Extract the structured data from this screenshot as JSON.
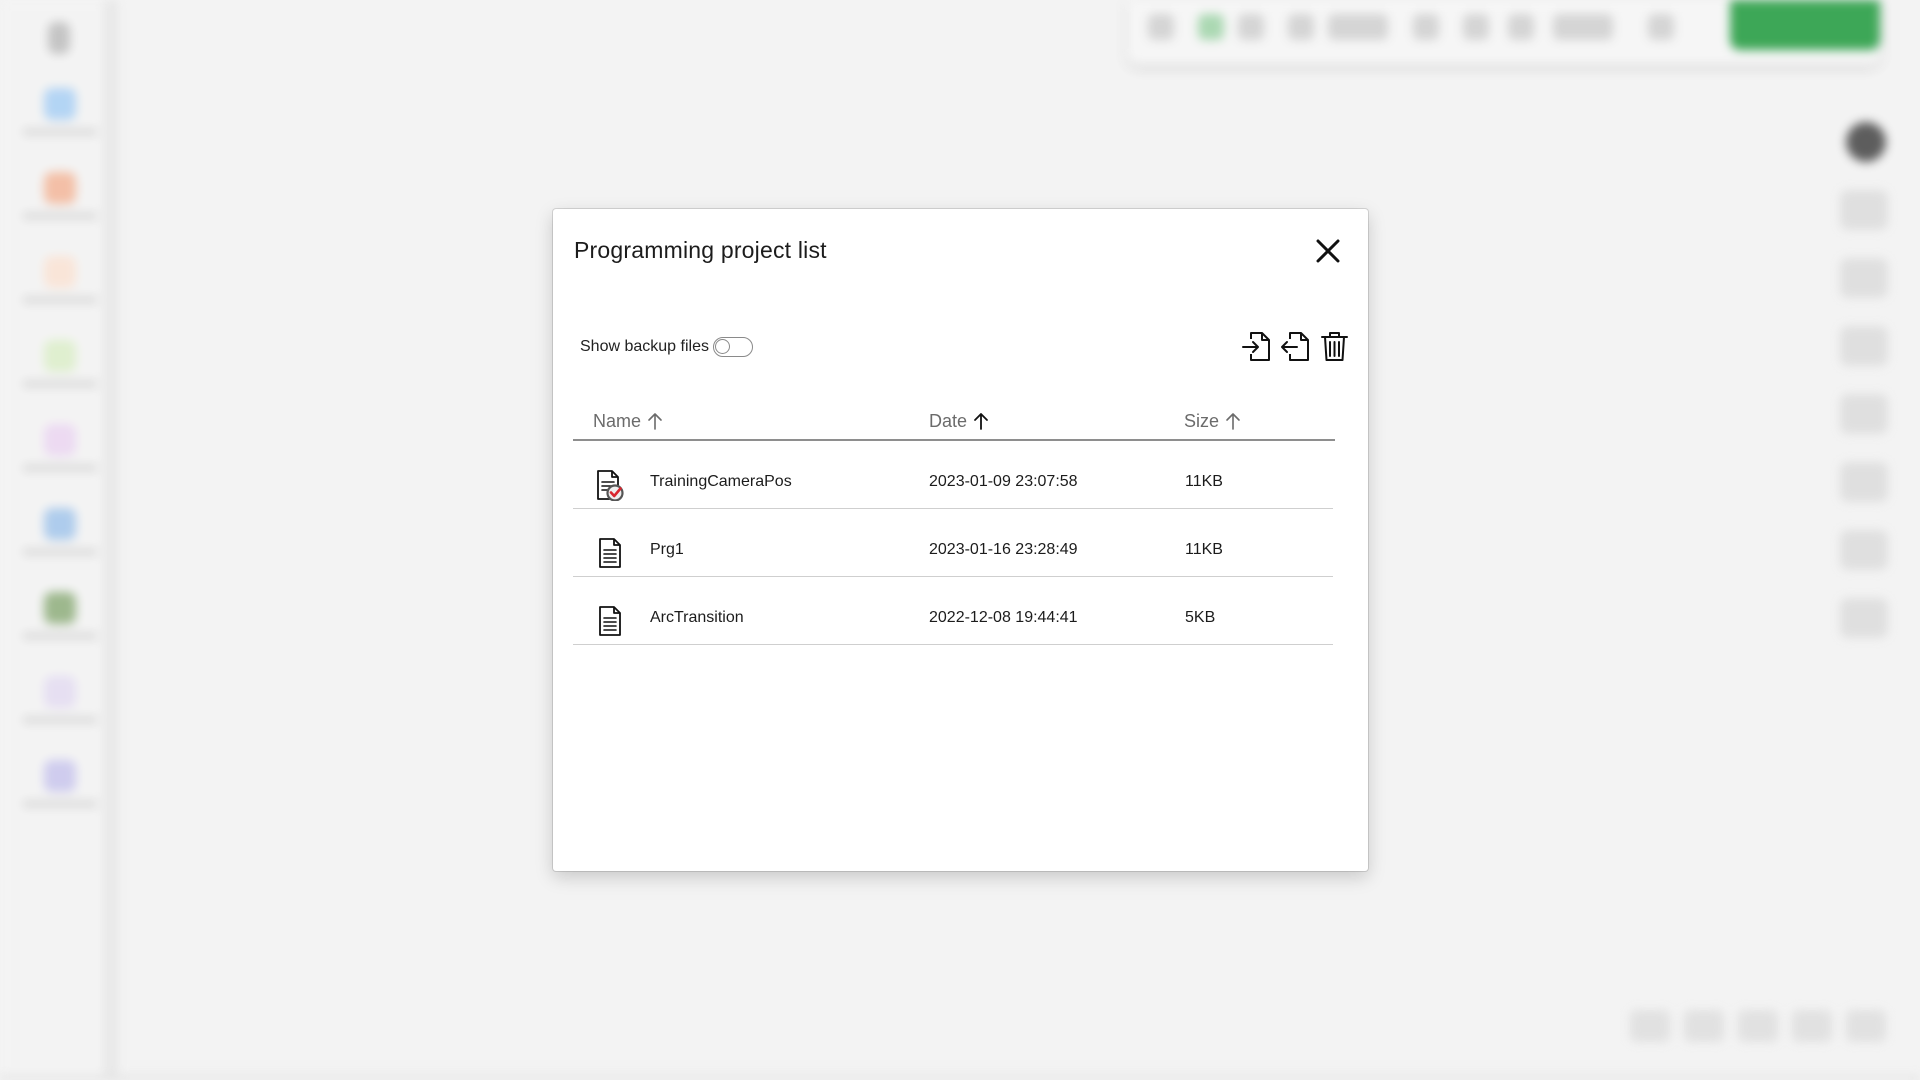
{
  "dialog": {
    "title": "Programming project list",
    "close_icon": "close-icon",
    "show_backup": {
      "label": "Show backup files",
      "enabled": false
    },
    "actions": [
      {
        "name": "import-icon"
      },
      {
        "name": "export-icon"
      },
      {
        "name": "trash-icon"
      }
    ],
    "columns": {
      "name": "Name",
      "date": "Date",
      "size": "Size",
      "sort_icon": "arrow-up-icon"
    },
    "rows": [
      {
        "name": "TrainingCameraPos",
        "date": "2023-01-09 23:07:58",
        "size": "11KB",
        "icon": "document-check-icon",
        "active": true
      },
      {
        "name": "Prg1",
        "date": "2023-01-16 23:28:49",
        "size": "11KB",
        "icon": "document-icon",
        "active": false
      },
      {
        "name": "ArcTransition",
        "date": "2022-12-08 19:44:41",
        "size": "5KB",
        "icon": "document-icon",
        "active": false
      }
    ],
    "colors": {
      "check_badge": "#d9262f",
      "check_ring": "#555555"
    }
  }
}
